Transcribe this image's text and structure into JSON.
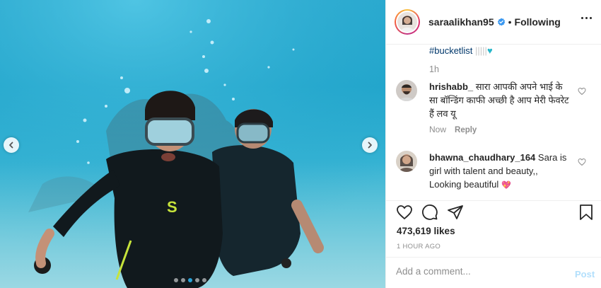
{
  "post": {
    "image_alt_icon": "underwater-photo",
    "carousel": {
      "total": 5,
      "active_index": 2
    }
  },
  "header": {
    "username": "saraalikhan95",
    "verified_icon": "verified-badge-icon",
    "separator": "•",
    "follow_status": "Following",
    "more_icon": "more-options-icon"
  },
  "caption": {
    "hashtag": "#bucketlist",
    "faded_text": "|||||",
    "heart": "♥",
    "time": "1h"
  },
  "comments": [
    {
      "username": "hrishabb_",
      "text": "सारा आपकी अपने भाई के सा बॉन्डिंग काफी अच्छी है आप मेरी फेवरेट हैं लव यू",
      "time": "Now",
      "reply_label": "Reply"
    },
    {
      "username": "bhawna_chaudhary_164",
      "text": "Sara is girl with talent and beauty,, Looking beautiful",
      "emoji": "💖"
    }
  ],
  "stats": {
    "likes": "473,619 likes",
    "posted": "1 HOUR AGO"
  },
  "add_comment": {
    "placeholder": "Add a comment...",
    "post_label": "Post"
  },
  "colors": {
    "water": "#22a6cc",
    "link": "#00376b",
    "verified": "#3897f0",
    "post_disabled": "#b2dffc"
  }
}
